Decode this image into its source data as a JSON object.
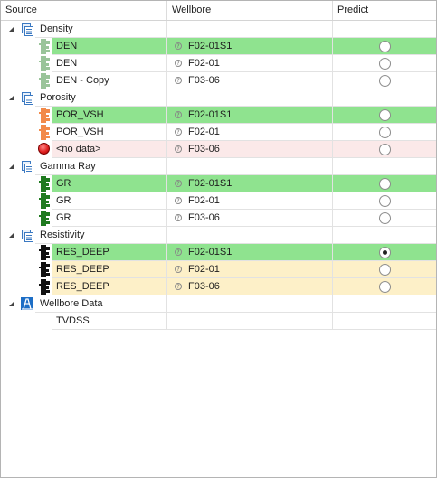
{
  "columns": {
    "source": "Source",
    "wellbore": "Wellbore",
    "predict": "Predict"
  },
  "groups": [
    {
      "name": "Density",
      "items": [
        {
          "source": "DEN",
          "wellbore": "F02-01S1",
          "highlight": "green",
          "selected": false,
          "icon_color": "#9ac49a"
        },
        {
          "source": "DEN",
          "wellbore": "F02-01",
          "highlight": "none",
          "selected": false,
          "icon_color": "#9ac49a"
        },
        {
          "source": "DEN - Copy",
          "wellbore": "F03-06",
          "highlight": "none",
          "selected": false,
          "icon_color": "#9ac49a"
        }
      ]
    },
    {
      "name": "Porosity",
      "items": [
        {
          "source": "POR_VSH",
          "wellbore": "F02-01S1",
          "highlight": "green",
          "selected": false,
          "icon_color": "#f28a4a"
        },
        {
          "source": "POR_VSH",
          "wellbore": "F02-01",
          "highlight": "none",
          "selected": false,
          "icon_color": "#f28a4a"
        },
        {
          "source": "<no data>",
          "wellbore": "F03-06",
          "highlight": "pink",
          "selected": false,
          "icon_color": "error"
        }
      ]
    },
    {
      "name": "Gamma Ray",
      "items": [
        {
          "source": "GR",
          "wellbore": "F02-01S1",
          "highlight": "green",
          "selected": false,
          "icon_color": "#1f7a1f"
        },
        {
          "source": "GR",
          "wellbore": "F02-01",
          "highlight": "none",
          "selected": false,
          "icon_color": "#1f7a1f"
        },
        {
          "source": "GR",
          "wellbore": "F03-06",
          "highlight": "none",
          "selected": false,
          "icon_color": "#1f7a1f"
        }
      ]
    },
    {
      "name": "Resistivity",
      "items": [
        {
          "source": "RES_DEEP",
          "wellbore": "F02-01S1",
          "highlight": "green",
          "selected": true,
          "icon_color": "#111111"
        },
        {
          "source": "RES_DEEP",
          "wellbore": "F02-01",
          "highlight": "yellow",
          "selected": false,
          "icon_color": "#111111"
        },
        {
          "source": "RES_DEEP",
          "wellbore": "F03-06",
          "highlight": "yellow",
          "selected": false,
          "icon_color": "#111111"
        }
      ]
    }
  ],
  "wellbore_data": {
    "name": "Wellbore Data",
    "items": [
      {
        "source": "TVDSS"
      }
    ]
  },
  "colors": {
    "green": "#8fe38f",
    "pink": "#fbe9e9",
    "yellow": "#fdf0c8"
  }
}
